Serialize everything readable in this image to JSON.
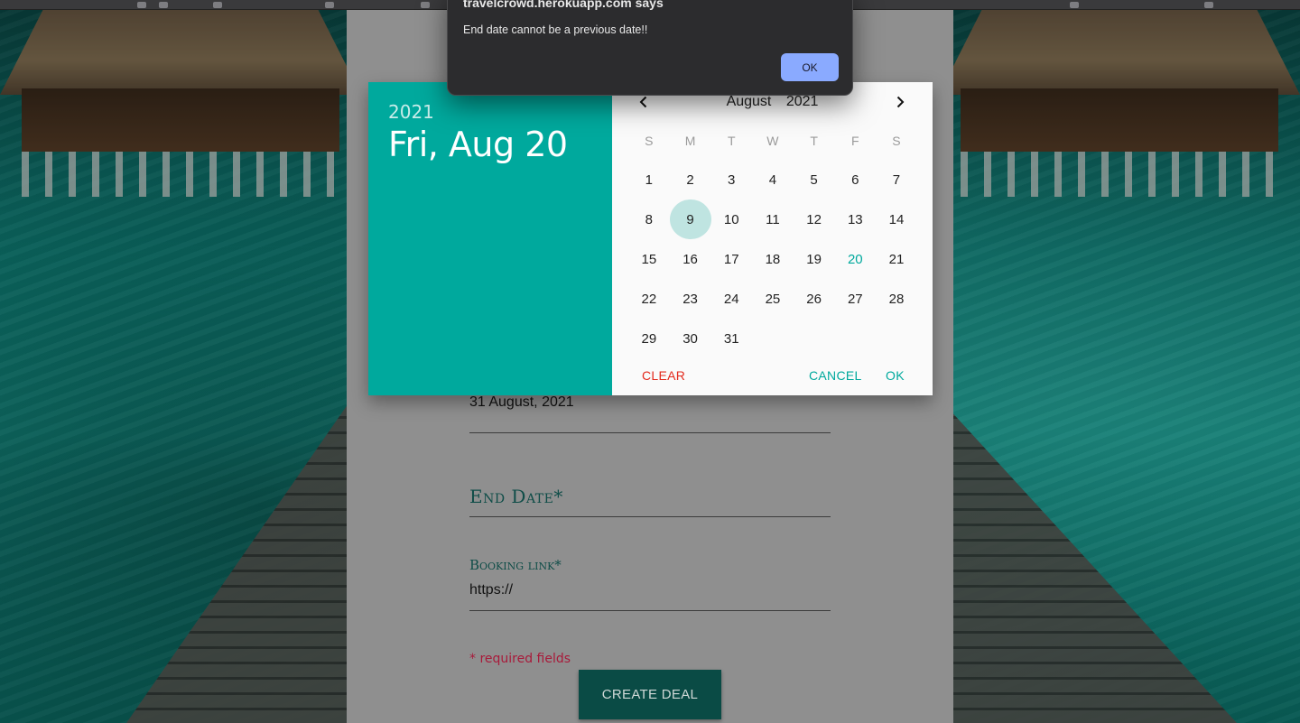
{
  "alert": {
    "title": "travelcrowd.herokuapp.com says",
    "message": "End date cannot be a previous date!!",
    "ok_label": "OK",
    "ok_color": "#8aaaff"
  },
  "datepicker": {
    "header_year": "2021",
    "header_date": "Fri, Aug 20",
    "month": "August",
    "year": "2021",
    "prev_icon": "chevron-left-icon",
    "next_icon": "chevron-right-icon",
    "weekdays": [
      "S",
      "M",
      "T",
      "W",
      "T",
      "F",
      "S"
    ],
    "days": [
      "1",
      "2",
      "3",
      "4",
      "5",
      "6",
      "7",
      "8",
      "9",
      "10",
      "11",
      "12",
      "13",
      "14",
      "15",
      "16",
      "17",
      "18",
      "19",
      "20",
      "21",
      "22",
      "23",
      "24",
      "25",
      "26",
      "27",
      "28",
      "29",
      "30",
      "31"
    ],
    "first_weekday_offset": 0,
    "selected_day": "9",
    "today_day": "20",
    "clear_label": "CLEAR",
    "cancel_label": "CANCEL",
    "ok_label": "OK",
    "accent_color": "#00a99d",
    "clear_color": "#e32a1d"
  },
  "form": {
    "start_date_value": "31 August, 2021",
    "end_date_label": "End Date*",
    "booking_label": "Booking link*",
    "booking_value": "https://",
    "required_note": "* required fields",
    "create_button_label": "CREATE DEAL"
  }
}
